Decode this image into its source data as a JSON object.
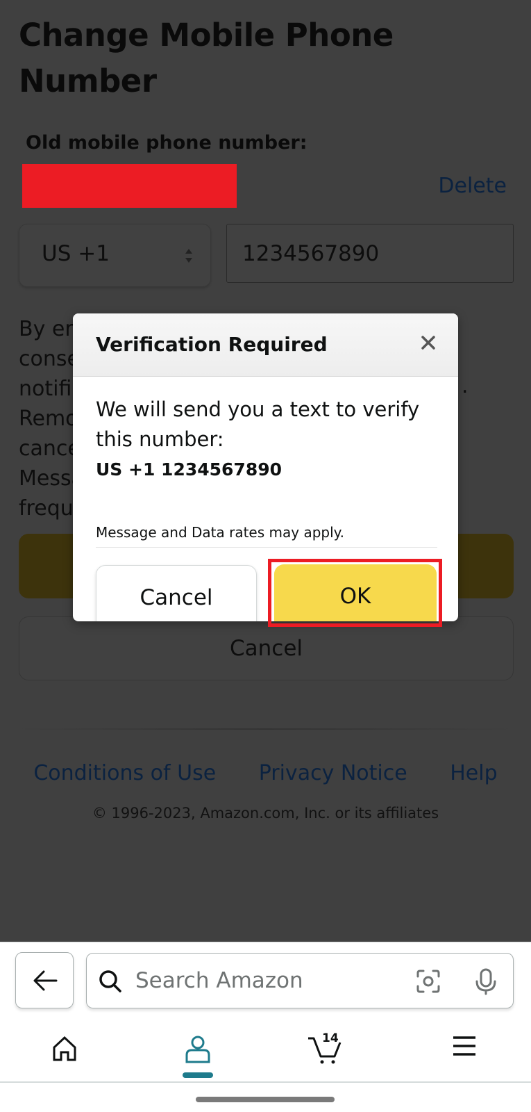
{
  "page": {
    "title": "Change Mobile Phone Number",
    "old_number_label": "Old mobile phone number:",
    "old_number_redacted": true,
    "delete_label": "Delete",
    "country_code": "US +1",
    "phone_value": "1234567890",
    "consent_fragments": [
      "By en",
      "conse",
      "notifi",
      "Remo",
      "cance",
      "Messa",
      "frequ"
    ],
    "consent_trailing": ".",
    "cancel_label": "Cancel"
  },
  "footer": {
    "links": [
      "Conditions of Use",
      "Privacy Notice",
      "Help"
    ],
    "copyright": "© 1996-2023, Amazon.com, Inc. or its affiliates"
  },
  "modal": {
    "title": "Verification Required",
    "body": "We will send you a text to verify this number:",
    "number": "US +1 1234567890",
    "note": "Message and Data rates may apply.",
    "cancel_label": "Cancel",
    "ok_label": "OK"
  },
  "bottom_bar": {
    "search_placeholder": "Search Amazon",
    "nav": [
      {
        "name": "home",
        "icon": "home-icon"
      },
      {
        "name": "you",
        "icon": "person-icon",
        "active": true
      },
      {
        "name": "cart",
        "icon": "cart-icon",
        "count": "14"
      },
      {
        "name": "menu",
        "icon": "hamburger-menu-icon"
      }
    ]
  },
  "colors": {
    "overlay_bg": "#404040",
    "ok_button": "#f7d94c",
    "highlight": "#ec1c24",
    "active_nav": "#1e7b8c",
    "link": "#0b2240"
  }
}
